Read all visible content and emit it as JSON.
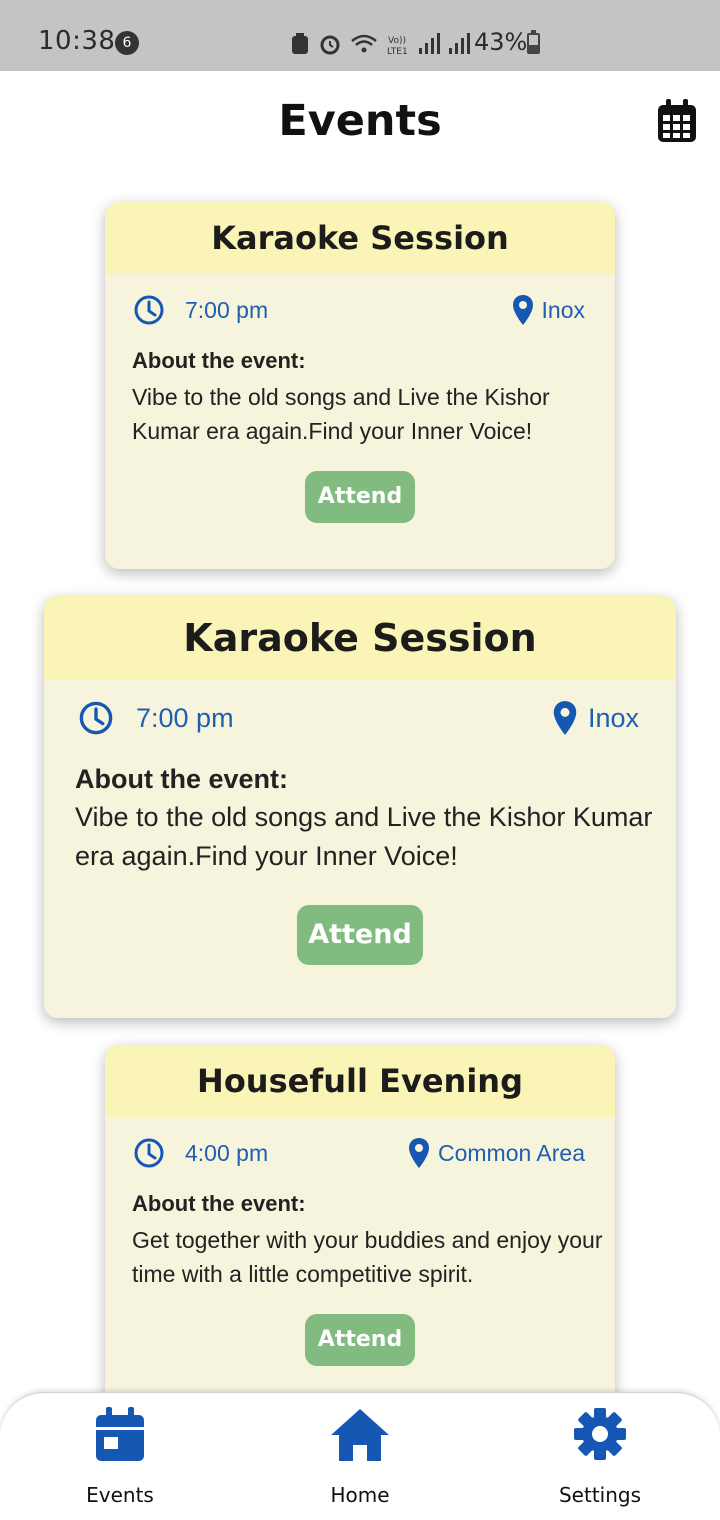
{
  "status_bar": {
    "time": "10:38",
    "notification_count": "6",
    "battery": "43%"
  },
  "header": {
    "title": "Events",
    "calendar_icon": "calendar-icon"
  },
  "events": [
    {
      "title": "Karaoke Session",
      "time": "7:00 pm",
      "location": "Inox",
      "about_label": "About the event:",
      "about_text": "Vibe to the old songs and Live the Kishor Kumar era again.Find your Inner Voice!",
      "button": "Attend"
    },
    {
      "title": "Karaoke Session",
      "time": "7:00 pm",
      "location": "Inox",
      "about_label": "About the event:",
      "about_text": "Vibe to the old songs and Live the Kishor Kumar era again.Find your Inner Voice!",
      "button": "Attend"
    },
    {
      "title": "Housefull Evening",
      "time": "4:00 pm",
      "location": "Common Area",
      "about_label": "About the event:",
      "about_text": "Get together with your buddies and enjoy your time with a little competitive spirit.",
      "button": "Attend"
    }
  ],
  "bottom_nav": {
    "items": [
      {
        "label": "Events",
        "icon": "calendar-icon"
      },
      {
        "label": "Home",
        "icon": "home-icon"
      },
      {
        "label": "Settings",
        "icon": "gear-icon"
      }
    ]
  },
  "colors": {
    "accent_blue": "#1757b4",
    "card_bg": "#f6f4dd",
    "card_header": "#faf4b6",
    "attend_button": "#82bb80"
  }
}
